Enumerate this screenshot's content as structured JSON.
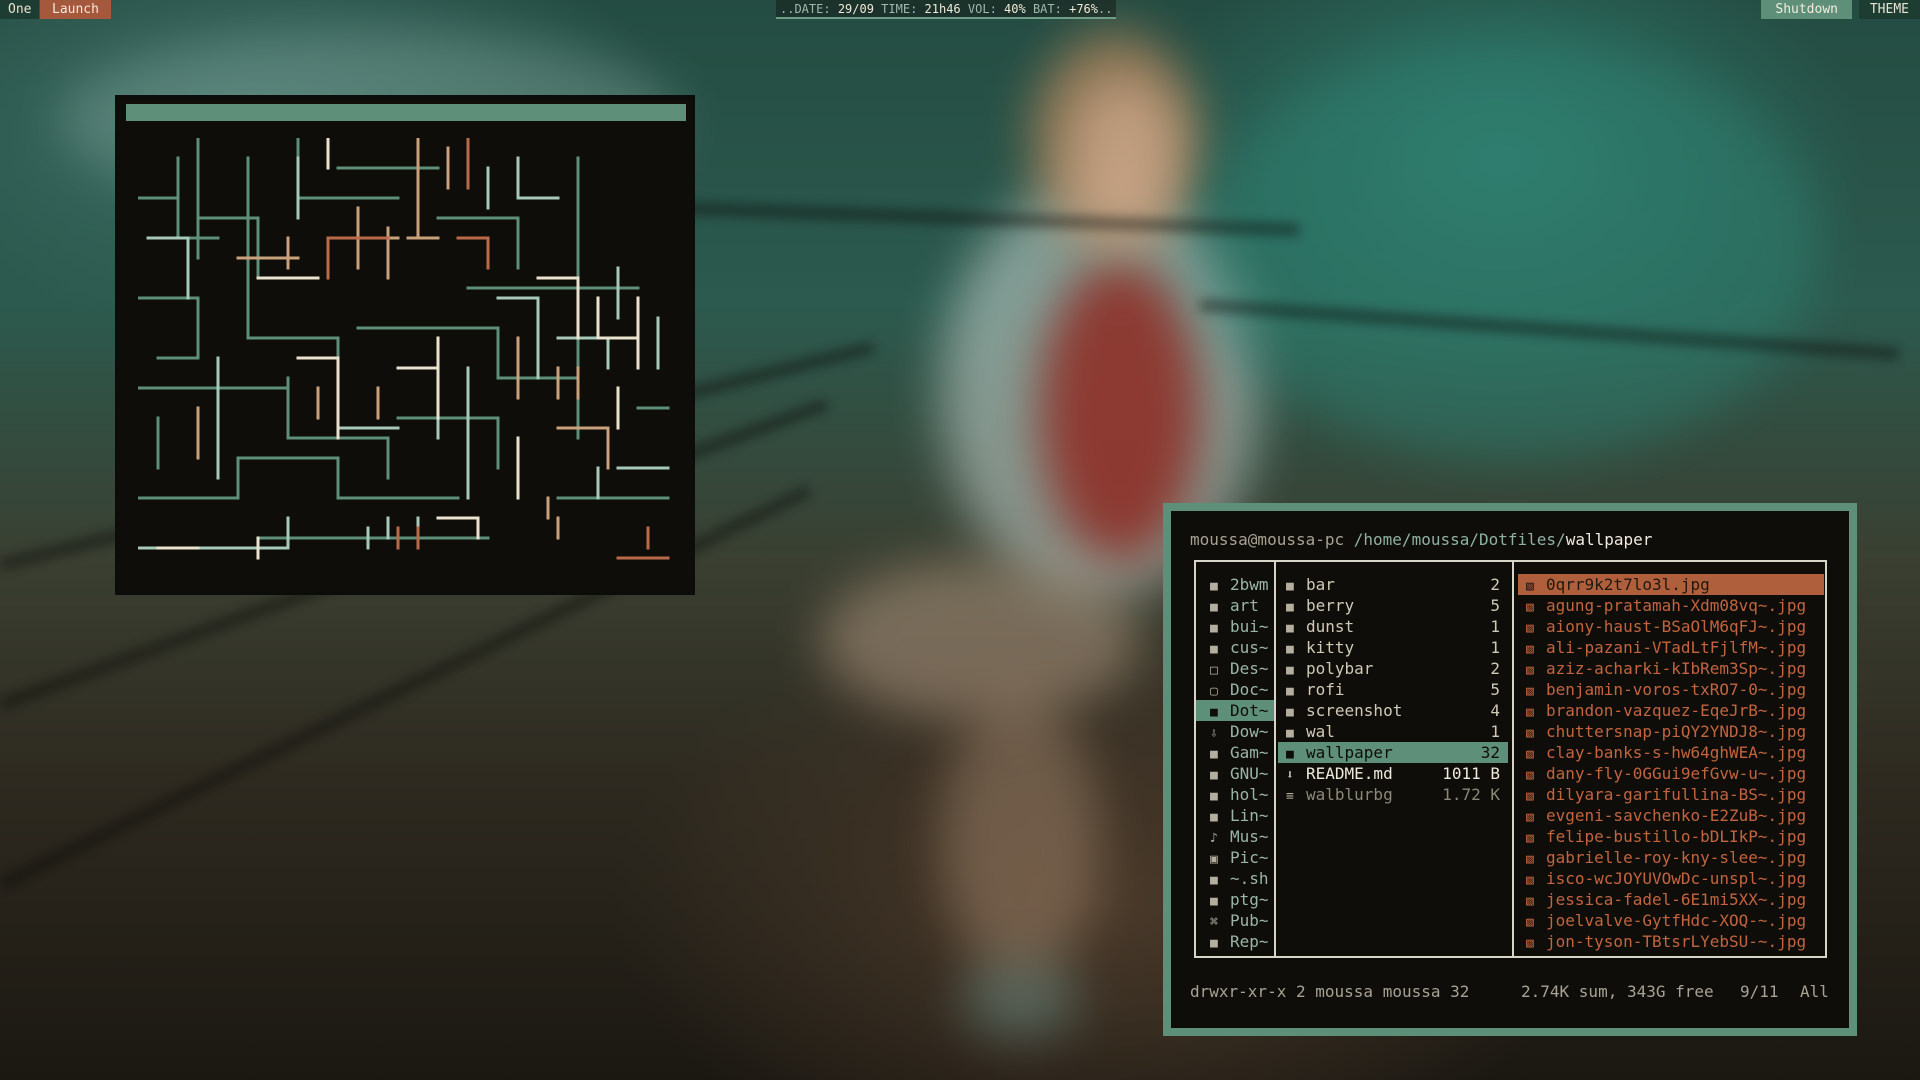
{
  "topbar": {
    "workspace": "One",
    "launch": "Launch",
    "status": {
      "prefix": "..",
      "date_label": "DATE:",
      "date": "29/09",
      "time_label": "TIME:",
      "time": "21h46",
      "vol_label": "VOL:",
      "vol": "40%",
      "bat_label": "BAT:",
      "bat": "+76%",
      "suffix": ".."
    },
    "shutdown": "Shutdown",
    "theme": "THEME"
  },
  "colors": {
    "accent_green": "#5e8f78",
    "accent_orange": "#a5583b",
    "terminal_bg": "#0f0d09",
    "text_light": "#efeadc"
  },
  "file_manager": {
    "prompt": {
      "user_host": "moussa@moussa-pc",
      "dir": "/home/moussa/Dotfiles/",
      "current": "wallpaper"
    },
    "parent_column": [
      {
        "icon": "folder-icon",
        "name": "2bwm"
      },
      {
        "icon": "folder-icon",
        "name": "art"
      },
      {
        "icon": "folder-icon",
        "name": "bui~"
      },
      {
        "icon": "folder-icon",
        "name": "cus~"
      },
      {
        "icon": "desktop-icon",
        "name": "Des~"
      },
      {
        "icon": "document-icon",
        "name": "Doc~"
      },
      {
        "icon": "folder-icon",
        "name": "Dot~",
        "selected": true
      },
      {
        "icon": "download-icon",
        "name": "Dow~"
      },
      {
        "icon": "folder-icon",
        "name": "Gam~"
      },
      {
        "icon": "folder-icon",
        "name": "GNU~"
      },
      {
        "icon": "folder-icon",
        "name": "hol~"
      },
      {
        "icon": "folder-icon",
        "name": "Lin~"
      },
      {
        "icon": "music-icon",
        "name": "Mus~"
      },
      {
        "icon": "picture-icon",
        "name": "Pic~"
      },
      {
        "icon": "folder-icon",
        "name": "~.sh"
      },
      {
        "icon": "folder-icon",
        "name": "ptg~"
      },
      {
        "icon": "public-icon",
        "name": "Pub~"
      },
      {
        "icon": "folder-icon",
        "name": "Rep~"
      }
    ],
    "current_column": [
      {
        "icon": "folder-icon",
        "name": "bar",
        "count": "2"
      },
      {
        "icon": "folder-icon",
        "name": "berry",
        "count": "5"
      },
      {
        "icon": "folder-icon",
        "name": "dunst",
        "count": "1"
      },
      {
        "icon": "folder-icon",
        "name": "kitty",
        "count": "1"
      },
      {
        "icon": "folder-icon",
        "name": "polybar",
        "count": "2"
      },
      {
        "icon": "folder-icon",
        "name": "rofi",
        "count": "5"
      },
      {
        "icon": "folder-icon",
        "name": "screenshot",
        "count": "4"
      },
      {
        "icon": "folder-icon",
        "name": "wal",
        "count": "1"
      },
      {
        "icon": "folder-icon",
        "name": "wallpaper",
        "count": "32",
        "selected": true
      },
      {
        "icon": "markdown-icon",
        "name": "README.md",
        "count": "1011 B",
        "kind": "file"
      },
      {
        "icon": "text-file-icon",
        "name": "walblurbg",
        "count": "1.72 K",
        "kind": "muted"
      }
    ],
    "preview_column": [
      {
        "icon": "image-icon",
        "name": "0qrr9k2t7lo3l.jpg",
        "selected": true
      },
      {
        "icon": "image-icon",
        "name": "agung-pratamah-Xdm08vq~.jpg"
      },
      {
        "icon": "image-icon",
        "name": "aiony-haust-BSaOlM6qFJ~.jpg"
      },
      {
        "icon": "image-icon",
        "name": "ali-pazani-VTadLtFjlfM~.jpg"
      },
      {
        "icon": "image-icon",
        "name": "aziz-acharki-kIbRem3Sp~.jpg"
      },
      {
        "icon": "image-icon",
        "name": "benjamin-voros-txRO7-0~.jpg"
      },
      {
        "icon": "image-icon",
        "name": "brandon-vazquez-EqeJrB~.jpg"
      },
      {
        "icon": "image-icon",
        "name": "chuttersnap-piQY2YNDJ8~.jpg"
      },
      {
        "icon": "image-icon",
        "name": "clay-banks-s-hw64ghWEA~.jpg"
      },
      {
        "icon": "image-icon",
        "name": "dany-fly-0GGui9efGvw-u~.jpg"
      },
      {
        "icon": "image-icon",
        "name": "dilyara-garifullina-BS~.jpg"
      },
      {
        "icon": "image-icon",
        "name": "evgeni-savchenko-E2ZuB~.jpg"
      },
      {
        "icon": "image-icon",
        "name": "felipe-bustillo-bDLIkP~.jpg"
      },
      {
        "icon": "image-icon",
        "name": "gabrielle-roy-kny-slee~.jpg"
      },
      {
        "icon": "image-icon",
        "name": "isco-wcJOYUVOwDc-unspl~.jpg"
      },
      {
        "icon": "image-icon",
        "name": "jessica-fadel-6E1mi5XX~.jpg"
      },
      {
        "icon": "image-icon",
        "name": "joelvalve-GytfHdc-XOQ-~.jpg"
      },
      {
        "icon": "image-icon",
        "name": "jon-tyson-TBtsrLYebSU-~.jpg"
      }
    ],
    "statusbar": {
      "permissions": "drwxr-xr-x",
      "links": "2",
      "owner": "moussa",
      "group": "moussa",
      "size": "32",
      "summary": "2.74K sum, 343G free",
      "position": "9/11",
      "scroll": "All"
    }
  }
}
